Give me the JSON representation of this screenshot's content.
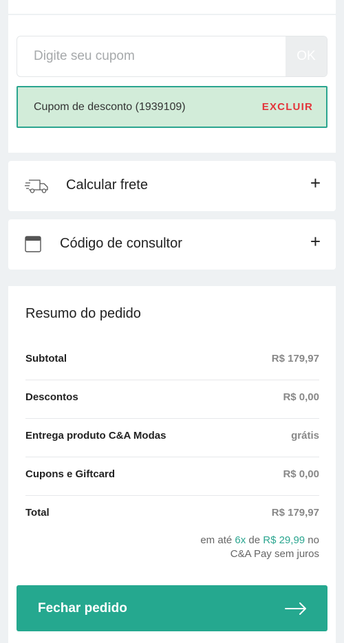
{
  "coupon": {
    "placeholder": "Digite seu cupom",
    "ok_label": "OK",
    "applied_text": "Cupom de desconto (1939109)",
    "remove_label": "EXCLUIR"
  },
  "shipping": {
    "label": "Calcular frete",
    "icon": "truck-icon",
    "expand_icon": "+"
  },
  "consultant": {
    "label": "Código de consultor",
    "icon": "calendar-icon",
    "expand_icon": "+"
  },
  "summary": {
    "title": "Resumo do pedido",
    "rows": [
      {
        "label": "Subtotal",
        "value": "R$ 179,97"
      },
      {
        "label": "Descontos",
        "value": "R$ 0,00"
      },
      {
        "label": "Entrega produto C&A Modas",
        "value": "grátis"
      },
      {
        "label": "Cupons e Giftcard",
        "value": "R$ 0,00"
      },
      {
        "label": "Total",
        "value": "R$ 179,97"
      }
    ],
    "installment": {
      "prefix": "em até ",
      "count": "6x",
      "mid": " de ",
      "amount": "R$ 29,99",
      "suffix_line1": " no",
      "line2": "C&A Pay sem juros"
    }
  },
  "checkout": {
    "label": "Fechar pedido",
    "icon": "arrow-right-icon"
  },
  "colors": {
    "accent": "#25a88f",
    "danger": "#e3353b",
    "coupon_bg": "#d2ecd9"
  }
}
